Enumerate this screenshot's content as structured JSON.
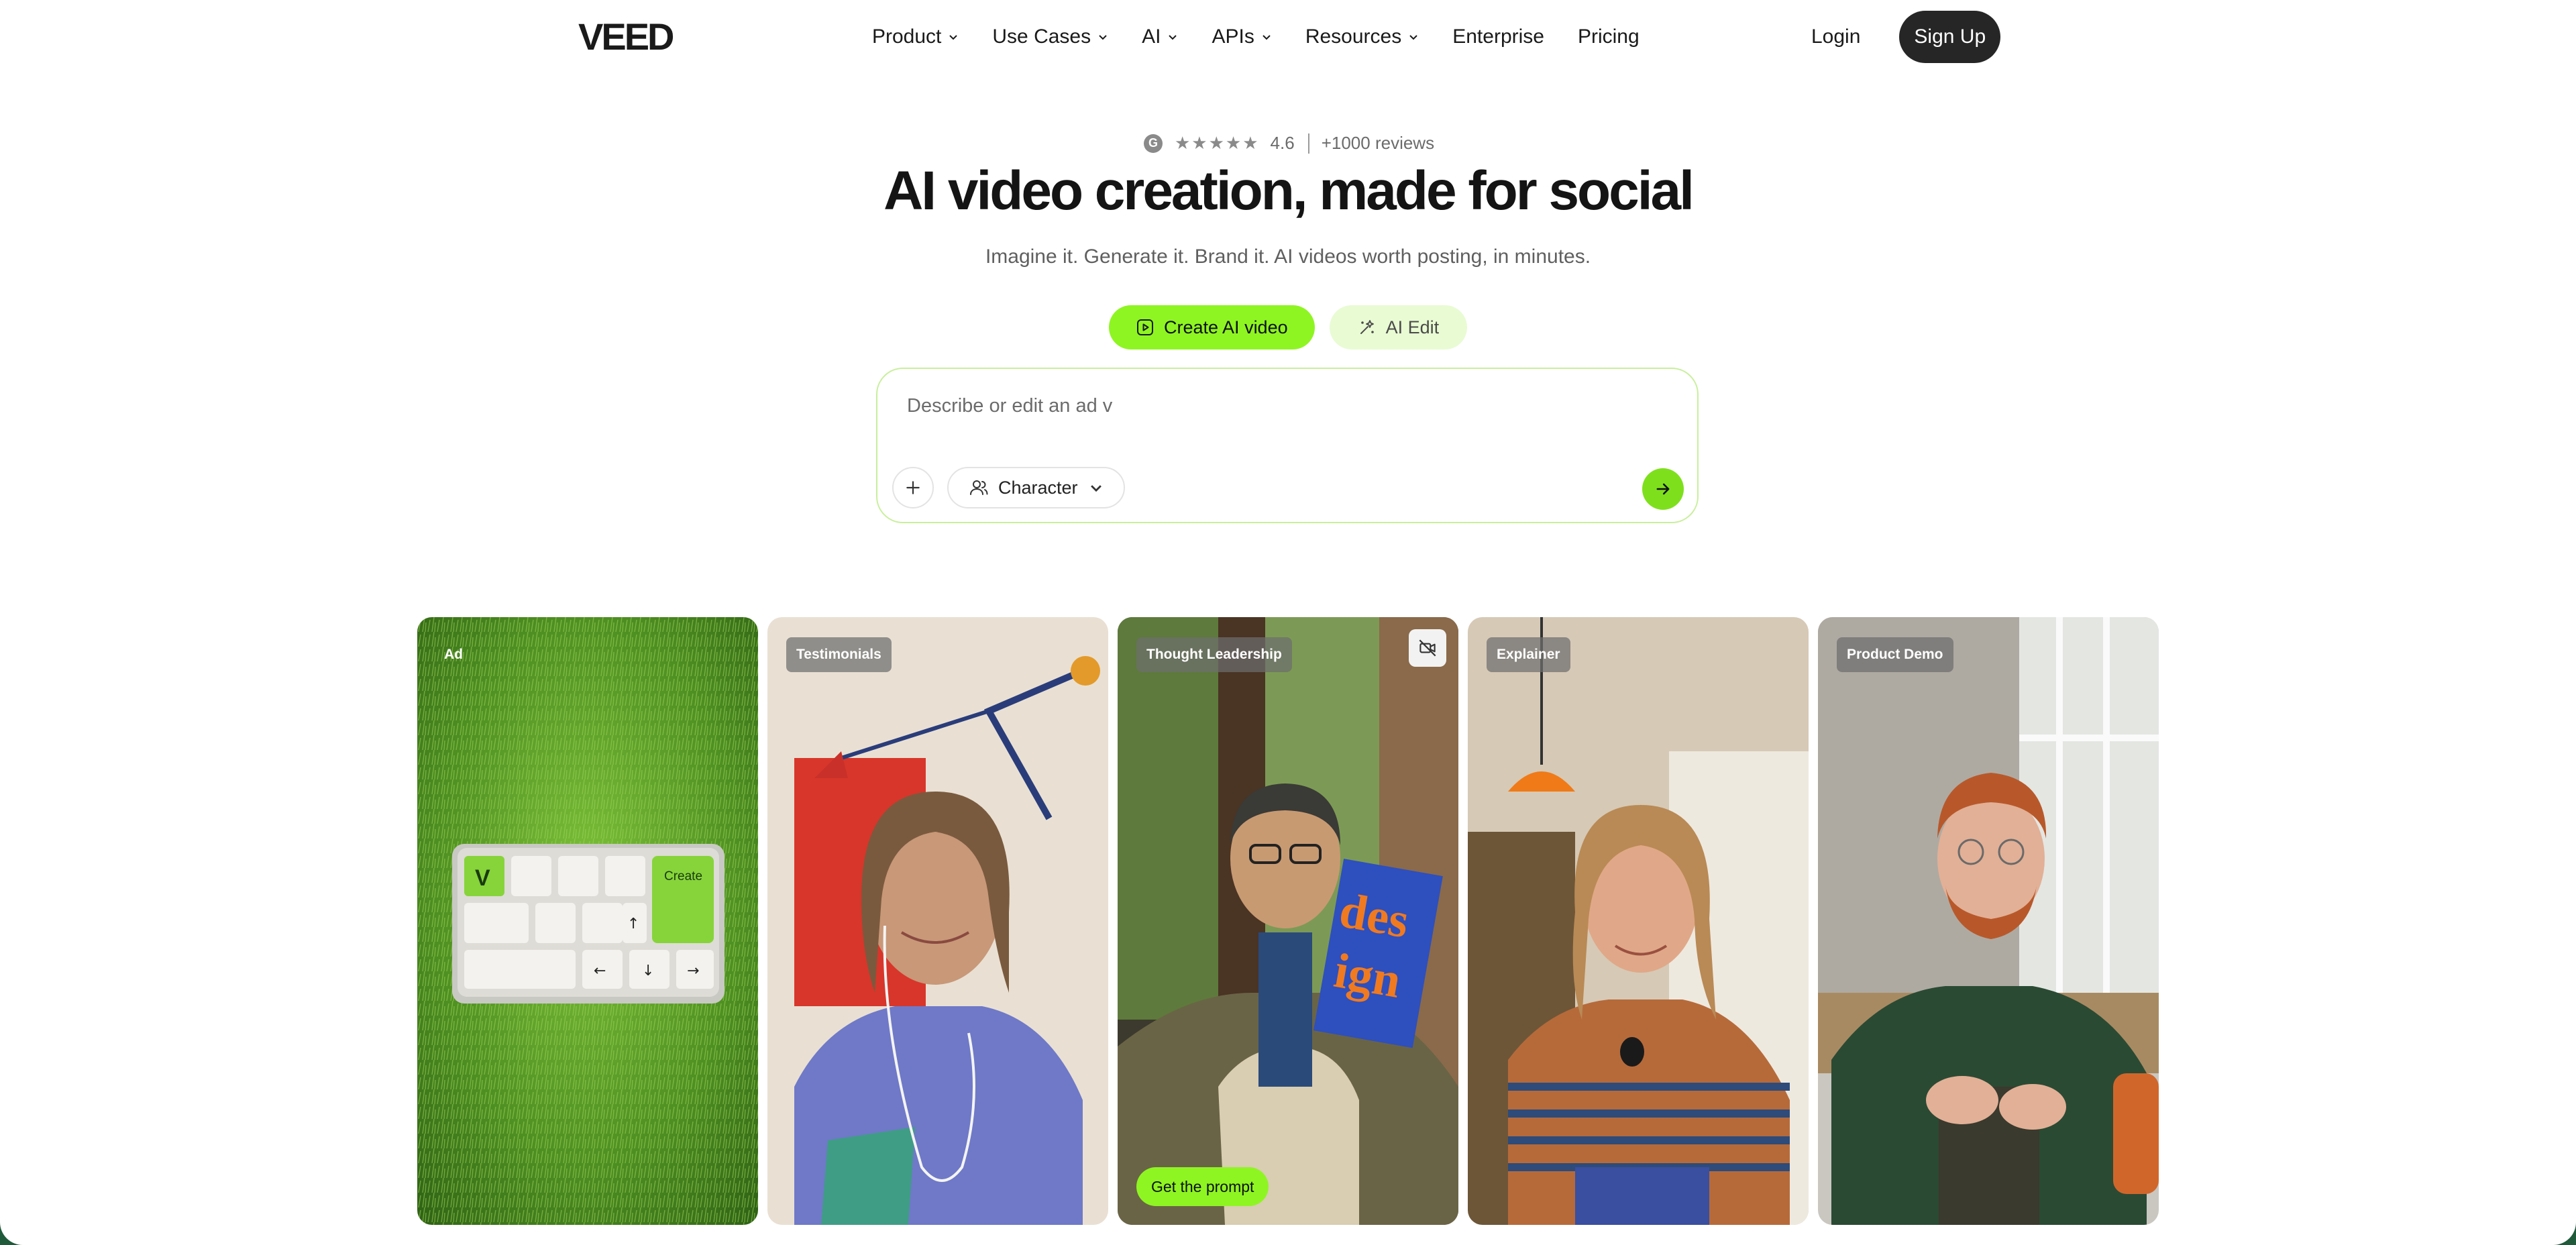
{
  "header": {
    "logo_text": "VEED",
    "nav": [
      {
        "label": "Product",
        "has_dropdown": true
      },
      {
        "label": "Use Cases",
        "has_dropdown": true
      },
      {
        "label": "AI",
        "has_dropdown": true
      },
      {
        "label": "APIs",
        "has_dropdown": true
      },
      {
        "label": "Resources",
        "has_dropdown": true
      },
      {
        "label": "Enterprise",
        "has_dropdown": false
      },
      {
        "label": "Pricing",
        "has_dropdown": false
      }
    ],
    "login_label": "Login",
    "signup_label": "Sign Up"
  },
  "hero": {
    "rating": {
      "icon": "g-logo-icon",
      "stars": "★★★★★",
      "score": "4.6",
      "reviews": "+1000 reviews"
    },
    "title": "AI video creation, made for social",
    "subtitle": "Imagine it. Generate it. Brand it. AI videos worth posting, in minutes.",
    "modes": [
      {
        "label": "Create AI video",
        "icon": "play-square-icon",
        "active": true
      },
      {
        "label": "AI Edit",
        "icon": "sparkle-edit-icon",
        "active": false
      }
    ],
    "prompt": {
      "value": "Describe or edit an ad v",
      "character_label": "Character"
    }
  },
  "cards": [
    {
      "badge": "Ad",
      "scene": "keyboard-on-grass"
    },
    {
      "badge": "Testimonials",
      "scene": "woman-with-earphones"
    },
    {
      "badge": "Thought Leadership",
      "scene": "man-with-design-book",
      "cta": "Get the prompt",
      "corner_icon": "no-camera-icon"
    },
    {
      "badge": "Explainer",
      "scene": "woman-in-kitchen"
    },
    {
      "badge": "Product Demo",
      "scene": "man-by-window"
    }
  ],
  "keyboard_key_label": "Create",
  "book_text": [
    "des",
    "ign"
  ],
  "colors": {
    "accent_green": "#8ef522",
    "accent_green_light": "#e9fbd3",
    "dark_button": "#262626",
    "footer_band": "#1f5a3a"
  }
}
